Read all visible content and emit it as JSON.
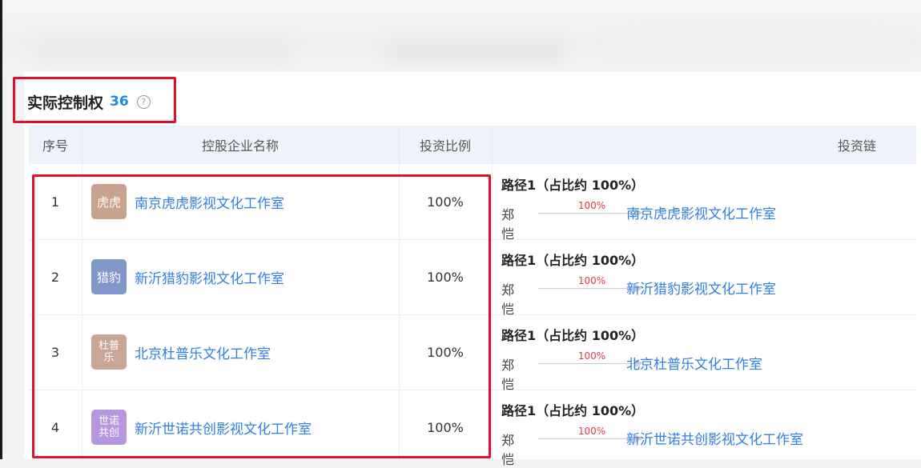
{
  "section": {
    "title": "实际控制权",
    "count": "36",
    "help_icon": "?"
  },
  "table": {
    "columns": [
      "序号",
      "控股企业名称",
      "投资比例",
      "投资链"
    ],
    "rows": [
      {
        "index": "1",
        "logo": "虎虎",
        "logo_color": "#c7a28e",
        "name": "南京虎虎影视文化工作室",
        "ratio": "100%",
        "chain": {
          "path_title": "路径1（占比约 100%）",
          "person": "郑恺",
          "edge_pct": "100%",
          "target": "南京虎虎影视文化工作室"
        }
      },
      {
        "index": "2",
        "logo": "猎豹",
        "logo_color": "#8197c9",
        "name": "新沂猎豹影视文化工作室",
        "ratio": "100%",
        "chain": {
          "path_title": "路径1（占比约 100%）",
          "person": "郑恺",
          "edge_pct": "100%",
          "target": "新沂猎豹影视文化工作室"
        }
      },
      {
        "index": "3",
        "logo": "杜普乐",
        "logo_color": "#c9a797",
        "name": "北京杜普乐文化工作室",
        "ratio": "100%",
        "chain": {
          "path_title": "路径1（占比约 100%）",
          "person": "郑恺",
          "edge_pct": "100%",
          "target": "北京杜普乐文化工作室"
        }
      },
      {
        "index": "4",
        "logo": "世诺共创",
        "logo_color": "#b597de",
        "name": "新沂世诺共创影视文化工作室",
        "ratio": "100%",
        "chain": {
          "path_title": "路径1（占比约 100%）",
          "person": "郑恺",
          "edge_pct": "100%",
          "target": "新沂世诺共创影视文化工作室"
        }
      }
    ]
  },
  "colors": {
    "accent": "#2f7fe0",
    "highlight_border": "#e0102c",
    "edge_percent": "#e53945",
    "header_bg": "#eef2fb"
  }
}
